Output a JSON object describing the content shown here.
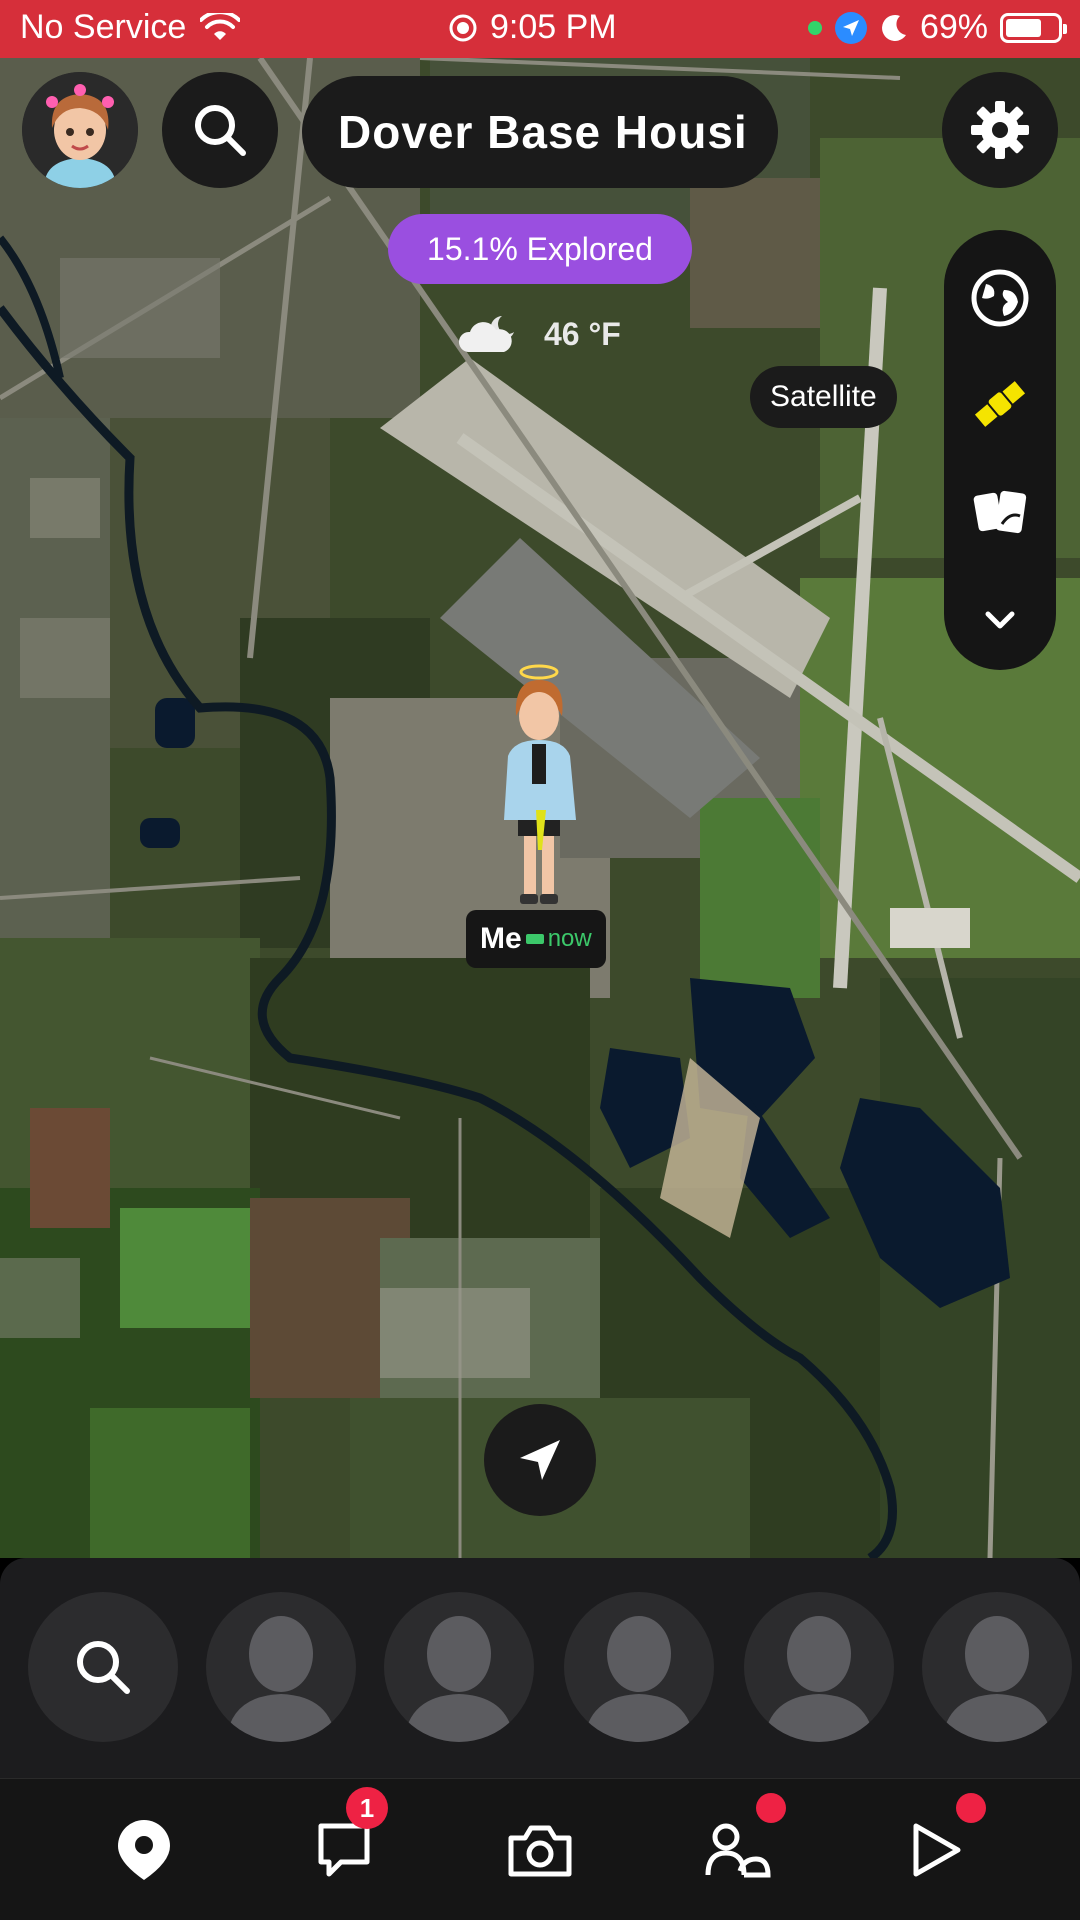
{
  "status_bar": {
    "carrier": "No Service",
    "time": "9:05 PM",
    "battery_percent": "69%",
    "battery_level": 0.69,
    "icons": [
      "wifi-icon",
      "screen-recording-icon",
      "location-arrow-icon",
      "moon-icon",
      "battery-icon"
    ]
  },
  "top_bar": {
    "location_name": "Dover Base Housi",
    "icons": [
      "avatar",
      "search-icon",
      "gear-icon"
    ]
  },
  "explored": {
    "label": "15.1% Explored"
  },
  "weather": {
    "temperature": "46 °F",
    "icon": "cloud-moon-icon"
  },
  "layers": {
    "active_label": "Satellite",
    "items": [
      "globe-icon",
      "satellite-icon",
      "memories-cards-icon",
      "chevron-down-icon"
    ],
    "active_color": "#f5e400"
  },
  "me_marker": {
    "name": "Me",
    "status": "now"
  },
  "friend_tray": {
    "items": [
      "search-icon",
      "friend-avatar",
      "friend-avatar",
      "friend-avatar",
      "friend-avatar",
      "friend-avatar"
    ]
  },
  "bottom_nav": {
    "items": [
      {
        "name": "map-icon",
        "active": true
      },
      {
        "name": "chat-icon",
        "badge": "1"
      },
      {
        "name": "camera-icon"
      },
      {
        "name": "friends-icon",
        "dot": true
      },
      {
        "name": "spotlight-icon",
        "dot": true
      }
    ],
    "badge_color": "#ee2244"
  },
  "colors": {
    "status_bar": "#d62f3a",
    "explored_pill": "#9a4fe0",
    "now_green": "#3cc86a"
  }
}
